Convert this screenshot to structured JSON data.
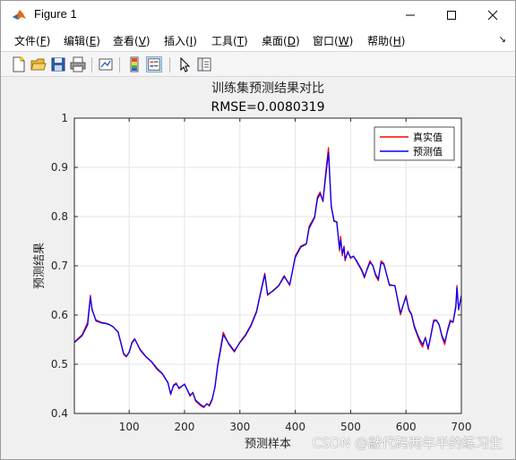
{
  "window": {
    "title": "Figure 1"
  },
  "menubar": {
    "items": [
      {
        "label": "文件(",
        "key": "F",
        "end": ")"
      },
      {
        "label": "编辑(",
        "key": "E",
        "end": ")"
      },
      {
        "label": "查看(",
        "key": "V",
        "end": ")"
      },
      {
        "label": "插入(",
        "key": "I",
        "end": ")"
      },
      {
        "label": "工具(",
        "key": "T",
        "end": ")"
      },
      {
        "label": "桌面(",
        "key": "D",
        "end": ")"
      },
      {
        "label": "窗口(",
        "key": "W",
        "end": ")"
      },
      {
        "label": "帮助(",
        "key": "H",
        "end": ")"
      }
    ]
  },
  "toolbar": {
    "icons": [
      "new-figure-icon",
      "open-file-icon",
      "save-icon",
      "print-icon",
      "link-plot-icon",
      "colorbar-icon",
      "legend-icon",
      "pointer-icon",
      "property-editor-icon"
    ]
  },
  "colors": {
    "true_series": "#ff0000",
    "pred_series": "#0000ff",
    "axes_bg": "#ffffff",
    "grid": "#e5e5e5"
  },
  "watermark": "CSDN @敲代码两年半的练习生",
  "chart_data": {
    "type": "line",
    "title": "训练集预测结果对比",
    "subtitle": "RMSE=0.0080319",
    "xlabel": "预测样本",
    "ylabel": "预测结果",
    "xlim": [
      1,
      700
    ],
    "ylim": [
      0.4,
      1.0
    ],
    "xticks": [
      100,
      200,
      300,
      400,
      500,
      600,
      700
    ],
    "yticks": [
      0.4,
      0.5,
      0.6,
      0.7,
      0.8,
      0.9,
      1.0
    ],
    "ytick_labels": [
      "0.4",
      "0.5",
      "0.6",
      "0.7",
      "0.8",
      "0.9",
      "1"
    ],
    "grid": true,
    "legend_position": "top-right",
    "x": [
      1,
      15,
      25,
      30,
      33,
      40,
      50,
      60,
      65,
      70,
      80,
      90,
      95,
      100,
      105,
      110,
      120,
      130,
      140,
      150,
      160,
      170,
      175,
      180,
      185,
      190,
      200,
      210,
      215,
      220,
      230,
      235,
      240,
      245,
      250,
      255,
      260,
      270,
      280,
      290,
      300,
      310,
      320,
      330,
      340,
      345,
      350,
      360,
      370,
      380,
      390,
      400,
      410,
      420,
      425,
      430,
      435,
      440,
      445,
      450,
      455,
      460,
      465,
      470,
      475,
      480,
      482,
      485,
      488,
      490,
      495,
      500,
      505,
      510,
      515,
      520,
      525,
      530,
      535,
      540,
      545,
      550,
      555,
      560,
      570,
      580,
      590,
      600,
      605,
      610,
      615,
      620,
      625,
      630,
      635,
      640,
      645,
      650,
      655,
      660,
      665,
      670,
      675,
      680,
      685,
      690,
      692,
      695,
      700
    ],
    "series": [
      {
        "name": "真实值",
        "color": "#ff0000",
        "values": [
          0.545,
          0.56,
          0.585,
          0.64,
          0.61,
          0.59,
          0.585,
          0.583,
          0.58,
          0.577,
          0.565,
          0.52,
          0.515,
          0.525,
          0.545,
          0.552,
          0.528,
          0.515,
          0.505,
          0.49,
          0.48,
          0.462,
          0.438,
          0.458,
          0.462,
          0.45,
          0.46,
          0.435,
          0.443,
          0.425,
          0.415,
          0.412,
          0.42,
          0.415,
          0.428,
          0.455,
          0.5,
          0.565,
          0.54,
          0.525,
          0.545,
          0.56,
          0.58,
          0.608,
          0.66,
          0.685,
          0.64,
          0.65,
          0.66,
          0.68,
          0.66,
          0.72,
          0.74,
          0.745,
          0.78,
          0.79,
          0.8,
          0.84,
          0.85,
          0.83,
          0.89,
          0.94,
          0.82,
          0.79,
          0.79,
          0.73,
          0.76,
          0.72,
          0.74,
          0.71,
          0.73,
          0.715,
          0.72,
          0.71,
          0.7,
          0.69,
          0.675,
          0.695,
          0.71,
          0.7,
          0.68,
          0.67,
          0.71,
          0.705,
          0.66,
          0.66,
          0.6,
          0.64,
          0.61,
          0.6,
          0.575,
          0.56,
          0.545,
          0.535,
          0.555,
          0.53,
          0.56,
          0.59,
          0.59,
          0.58,
          0.555,
          0.54,
          0.57,
          0.59,
          0.585,
          0.62,
          0.66,
          0.61,
          0.64
        ]
      },
      {
        "name": "预测值",
        "color": "#0000ff",
        "values": [
          0.544,
          0.558,
          0.58,
          0.636,
          0.612,
          0.588,
          0.584,
          0.582,
          0.58,
          0.577,
          0.566,
          0.522,
          0.516,
          0.524,
          0.543,
          0.551,
          0.53,
          0.516,
          0.506,
          0.492,
          0.481,
          0.463,
          0.44,
          0.456,
          0.46,
          0.452,
          0.459,
          0.437,
          0.442,
          0.427,
          0.417,
          0.414,
          0.419,
          0.417,
          0.43,
          0.453,
          0.497,
          0.56,
          0.542,
          0.527,
          0.544,
          0.558,
          0.578,
          0.606,
          0.657,
          0.682,
          0.642,
          0.649,
          0.659,
          0.678,
          0.662,
          0.717,
          0.738,
          0.744,
          0.776,
          0.787,
          0.798,
          0.836,
          0.846,
          0.832,
          0.882,
          0.93,
          0.822,
          0.792,
          0.788,
          0.735,
          0.752,
          0.725,
          0.738,
          0.714,
          0.727,
          0.717,
          0.719,
          0.712,
          0.702,
          0.692,
          0.678,
          0.693,
          0.707,
          0.701,
          0.683,
          0.673,
          0.706,
          0.703,
          0.662,
          0.659,
          0.604,
          0.637,
          0.612,
          0.602,
          0.578,
          0.563,
          0.55,
          0.54,
          0.553,
          0.533,
          0.558,
          0.587,
          0.589,
          0.58,
          0.558,
          0.545,
          0.567,
          0.587,
          0.586,
          0.615,
          0.655,
          0.612,
          0.638
        ]
      }
    ]
  }
}
